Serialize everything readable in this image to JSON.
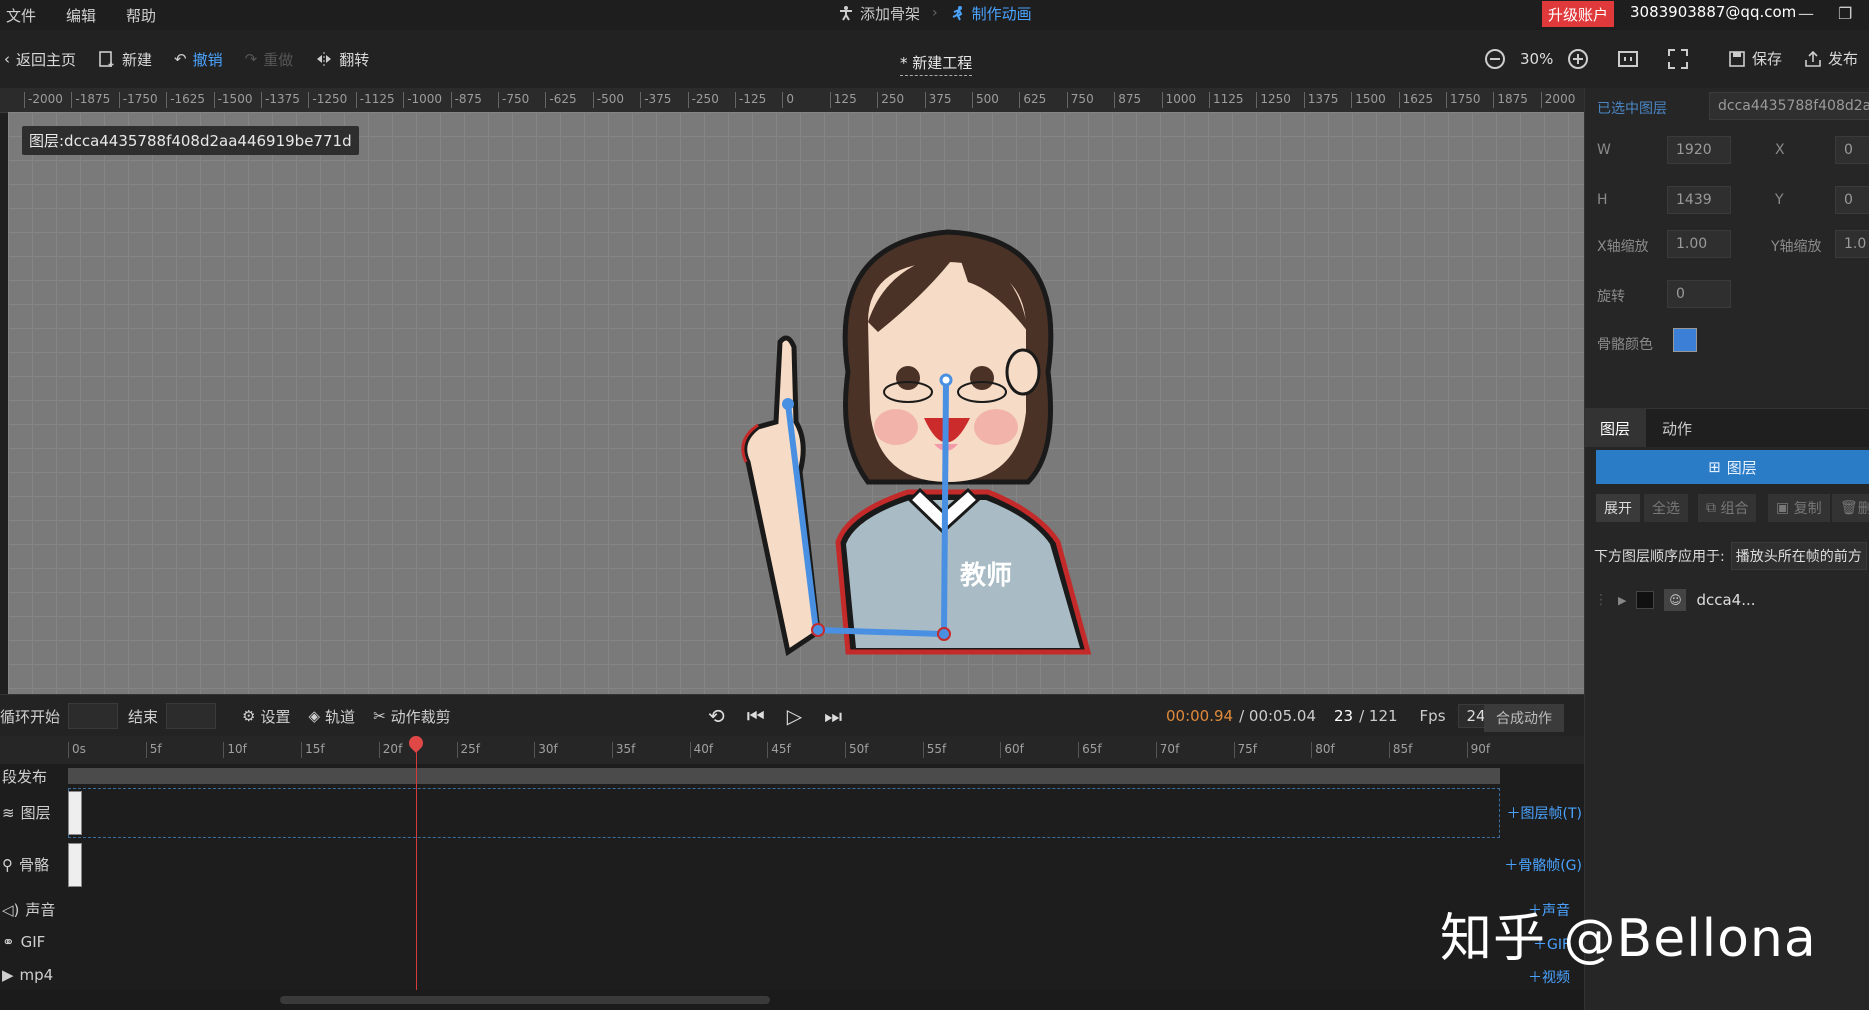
{
  "menu": [
    "文件",
    "编辑",
    "帮助"
  ],
  "steps": {
    "step1": "添加骨架",
    "step2": "制作动画"
  },
  "account": {
    "upgrade": "升级账户",
    "email": "3083903887@qq.com"
  },
  "toolbar": {
    "back": "返回主页",
    "new": "新建",
    "undo": "撤销",
    "redo": "重做",
    "flip": "翻转",
    "project_title": "* 新建工程",
    "zoom": "30%",
    "save": "保存",
    "publish": "发布"
  },
  "ruler_ticks": [
    "-2000",
    "-1875",
    "-1750",
    "-1625",
    "-1500",
    "-1375",
    "-1250",
    "-1125",
    "-1000",
    "-875",
    "-750",
    "-625",
    "-500",
    "-375",
    "-250",
    "-125",
    "0",
    "125",
    "250",
    "375",
    "500",
    "625",
    "750",
    "875",
    "1000",
    "1125",
    "1250",
    "1375",
    "1500",
    "1625",
    "1750",
    "1875",
    "2000"
  ],
  "canvas": {
    "layer_label": "图层:dcca4435788f408d2aa446919be771d"
  },
  "panel": {
    "selected_label": "已选中图层",
    "selected_value": "dcca4435788f408d2a",
    "w_label": "W",
    "w": "1920",
    "x_label": "X",
    "x": "0",
    "h_label": "H",
    "h": "1439",
    "y_label": "Y",
    "y": "0",
    "sx_label": "X轴缩放",
    "sx": "1.00",
    "sy_label": "Y轴缩放",
    "sy": "1.0",
    "rot_label": "旋转",
    "rot": "0",
    "bone_color_label": "骨骼颜色",
    "bone_color": "#3b7fd6"
  },
  "tabs": {
    "layers": "图层",
    "actions": "动作"
  },
  "layers": {
    "add": "图层",
    "expand": "展开",
    "select_all": "全选",
    "group": "组合",
    "copy": "复制",
    "delete": "删",
    "order_label": "下方图层顺序应用于:",
    "order_value": "播放头所在帧的前方",
    "item_name": "dcca4..."
  },
  "timeline": {
    "loop_start": "循环开始",
    "end": "结束",
    "settings": "设置",
    "track": "轨道",
    "crop": "动作裁剪",
    "time_current": "00:00.94",
    "time_total": "/ 00:05.04",
    "frame_current": "23",
    "frame_total": "/ 121",
    "fps_label": "Fps",
    "fps": "24",
    "compose": "合成动作",
    "frame_ticks": [
      "0s",
      "5f",
      "10f",
      "15f",
      "20f",
      "25f",
      "30f",
      "35f",
      "40f",
      "45f",
      "50f",
      "55f",
      "60f",
      "65f",
      "70f",
      "75f",
      "80f",
      "85f",
      "90f"
    ],
    "tracks": {
      "segment": "段发布",
      "layer": "图层",
      "bone": "骨骼",
      "sound": "声音",
      "gif": "GIF",
      "mp4": "mp4",
      "add_layer_frame": "图层帧(T)",
      "add_bone_frame": "骨骼帧(G)",
      "add_sound": "声音",
      "add_gif": "GIF",
      "add_video": "视频"
    }
  },
  "character": {
    "shirt_text": "教师"
  },
  "watermark": "知乎 @Bellona"
}
